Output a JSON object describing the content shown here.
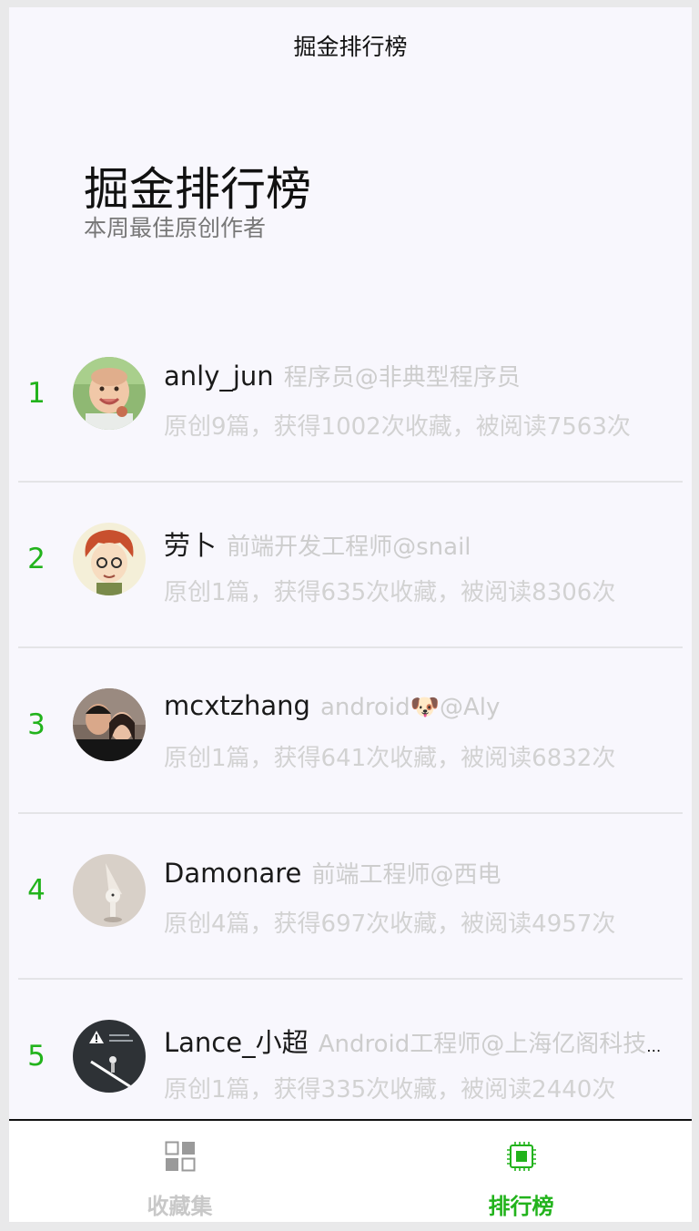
{
  "navbar": {
    "title": "掘金排行榜"
  },
  "hero": {
    "title": "掘金排行榜",
    "subtitle": "本周最佳原创作者"
  },
  "ranking": [
    {
      "rank": "1",
      "name": "anly_jun",
      "title": "程序员@非典型程序员",
      "stats": "原创9篇，获得1002次收藏，被阅读7563次"
    },
    {
      "rank": "2",
      "name": "劳卜",
      "title": "前端开发工程师@snail",
      "stats": "原创1篇，获得635次收藏，被阅读8306次"
    },
    {
      "rank": "3",
      "name": "mcxtzhang",
      "title": "android🐶@Aly",
      "stats": "原创1篇，获得641次收藏，被阅读6832次"
    },
    {
      "rank": "4",
      "name": "Damonare",
      "title": "前端工程师@西电",
      "stats": "原创4篇，获得697次收藏，被阅读4957次"
    },
    {
      "rank": "5",
      "name": "Lance_小超",
      "title": "Android工程师@上海亿阁科技有限公司",
      "stats": "原创1篇，获得335次收藏，被阅读2440次"
    }
  ],
  "tabbar": {
    "tabs": [
      {
        "label": "收藏集",
        "icon": "grid-icon",
        "active": false
      },
      {
        "label": "排行榜",
        "icon": "chip-icon",
        "active": true
      }
    ]
  },
  "colors": {
    "accent": "#22b31c",
    "muted": "#cdcdcd",
    "background": "#f8f7fd"
  }
}
